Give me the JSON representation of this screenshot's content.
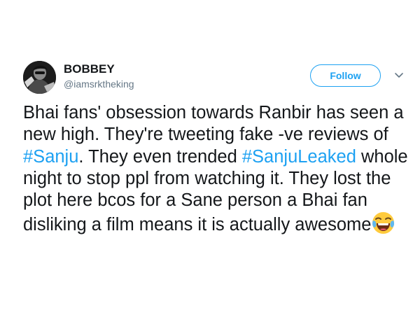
{
  "tweet": {
    "display_name": "BOBBEY",
    "handle": "@iamsrktheking",
    "follow_label": "Follow",
    "text": {
      "part1": "Bhai fans' obsession towards Ranbir has seen a new high. They're tweeting fake -ve reviews of ",
      "hashtag1": "#Sanju",
      "part2": ". They even trended ",
      "hashtag2": "#SanjuLeaked",
      "part3": " whole night to stop ppl from watching it. They lost the plot here bcos for a Sane person a Bhai fan disliking a film means it is actually awesome"
    },
    "emoji": "face-with-tears-of-joy",
    "colors": {
      "accent": "#1da1f2",
      "text": "#14171a",
      "secondary": "#657786"
    }
  }
}
